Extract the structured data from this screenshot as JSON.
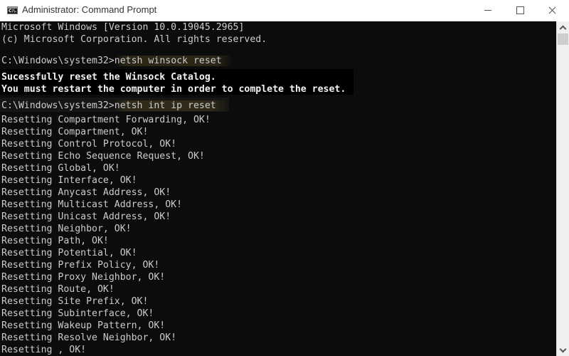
{
  "window": {
    "title": "Administrator: Command Prompt",
    "icon": "cmd-icon",
    "icon_text": "C:\\.",
    "controls": [
      "minimize",
      "maximize",
      "close"
    ]
  },
  "console": {
    "lines": [
      {
        "text": "Microsoft Windows [Version 10.0.19045.2965]",
        "kind": "normal"
      },
      {
        "text": "(c) Microsoft Corporation. All rights reserved.",
        "kind": "normal"
      },
      {
        "text": "",
        "kind": "normal"
      },
      {
        "prompt": "C:\\Windows\\system32>",
        "command": "netsh winsock reset",
        "kind": "command"
      },
      {
        "text": "Sucessfully reset the Winsock Catalog.",
        "kind": "bright"
      },
      {
        "text": "You must restart the computer in order to complete the reset.",
        "kind": "bright"
      },
      {
        "prompt": "C:\\Windows\\system32>",
        "command": "netsh int ip reset",
        "kind": "command"
      },
      {
        "text": "Resetting Compartment Forwarding, OK!",
        "kind": "normal"
      },
      {
        "text": "Resetting Compartment, OK!",
        "kind": "normal"
      },
      {
        "text": "Resetting Control Protocol, OK!",
        "kind": "normal"
      },
      {
        "text": "Resetting Echo Sequence Request, OK!",
        "kind": "normal"
      },
      {
        "text": "Resetting Global, OK!",
        "kind": "normal"
      },
      {
        "text": "Resetting Interface, OK!",
        "kind": "normal"
      },
      {
        "text": "Resetting Anycast Address, OK!",
        "kind": "normal"
      },
      {
        "text": "Resetting Multicast Address, OK!",
        "kind": "normal"
      },
      {
        "text": "Resetting Unicast Address, OK!",
        "kind": "normal"
      },
      {
        "text": "Resetting Neighbor, OK!",
        "kind": "normal"
      },
      {
        "text": "Resetting Path, OK!",
        "kind": "normal"
      },
      {
        "text": "Resetting Potential, OK!",
        "kind": "normal"
      },
      {
        "text": "Resetting Prefix Policy, OK!",
        "kind": "normal"
      },
      {
        "text": "Resetting Proxy Neighbor, OK!",
        "kind": "normal"
      },
      {
        "text": "Resetting Route, OK!",
        "kind": "normal"
      },
      {
        "text": "Resetting Site Prefix, OK!",
        "kind": "normal"
      },
      {
        "text": "Resetting Subinterface, OK!",
        "kind": "normal"
      },
      {
        "text": "Resetting Wakeup Pattern, OK!",
        "kind": "normal"
      },
      {
        "text": "Resetting Resolve Neighbor, OK!",
        "kind": "normal"
      },
      {
        "text": "Resetting , OK!",
        "kind": "normal"
      }
    ]
  },
  "colors": {
    "console_bg": "#0c0c0c",
    "console_text": "#cccccc",
    "titlebar_bg": "#ffffff"
  }
}
